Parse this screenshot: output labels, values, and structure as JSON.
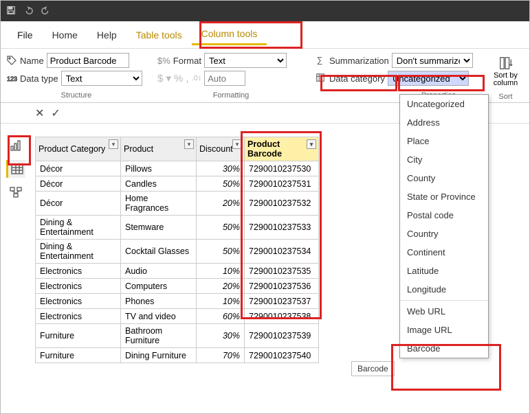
{
  "titlebar": {
    "save": "",
    "undo": "",
    "redo": ""
  },
  "menu": {
    "file": "File",
    "home": "Home",
    "help": "Help",
    "table_tools": "Table tools",
    "column_tools": "Column tools"
  },
  "ribbon": {
    "name_label": "Name",
    "name_value": "Product Barcode",
    "datatype_label": "Data type",
    "datatype_value": "Text",
    "format_label": "Format",
    "format_value": "Text",
    "auto_placeholder": "Auto",
    "summarization_label": "Summarization",
    "summarization_value": "Don't summarize",
    "datacategory_label": "Data category",
    "datacategory_value": "Uncategorized",
    "sort_label": "Sort by\ncolumn",
    "grp_structure": "Structure",
    "grp_formatting": "Formatting",
    "grp_properties": "Properties",
    "grp_sort": "Sort"
  },
  "table": {
    "headers": {
      "cat": "Product Category",
      "prod": "Product",
      "disc": "Discount",
      "barcode": "Product Barcode"
    },
    "rows": [
      {
        "cat": "Décor",
        "prod": "Pillows",
        "disc": "30%",
        "bar": "7290010237530"
      },
      {
        "cat": "Décor",
        "prod": "Candles",
        "disc": "50%",
        "bar": "7290010237531"
      },
      {
        "cat": "Décor",
        "prod": "Home Fragrances",
        "disc": "20%",
        "bar": "7290010237532"
      },
      {
        "cat": "Dining & Entertainment",
        "prod": "Stemware",
        "disc": "50%",
        "bar": "7290010237533"
      },
      {
        "cat": "Dining & Entertainment",
        "prod": "Cocktail Glasses",
        "disc": "50%",
        "bar": "7290010237534"
      },
      {
        "cat": "Electronics",
        "prod": "Audio",
        "disc": "10%",
        "bar": "7290010237535"
      },
      {
        "cat": "Electronics",
        "prod": "Computers",
        "disc": "20%",
        "bar": "7290010237536"
      },
      {
        "cat": "Electronics",
        "prod": "Phones",
        "disc": "10%",
        "bar": "7290010237537"
      },
      {
        "cat": "Electronics",
        "prod": "TV and video",
        "disc": "60%",
        "bar": "7290010237538"
      },
      {
        "cat": "Furniture",
        "prod": "Bathroom Furniture",
        "disc": "30%",
        "bar": "7290010237539"
      },
      {
        "cat": "Furniture",
        "prod": "Dining Furniture",
        "disc": "70%",
        "bar": "7290010237540"
      }
    ]
  },
  "dropdown": {
    "items1": [
      "Uncategorized",
      "Address",
      "Place",
      "City",
      "County",
      "State or Province",
      "Postal code",
      "Country",
      "Continent",
      "Latitude",
      "Longitude"
    ],
    "items2": [
      "Web URL",
      "Image URL",
      "Barcode"
    ]
  },
  "tooltip": "Barcode"
}
